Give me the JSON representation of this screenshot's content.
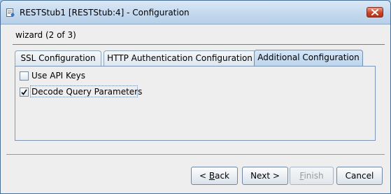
{
  "window": {
    "title": "RESTStub1 [RESTStub:4] - Configuration",
    "icon": "app-stub-icon",
    "close_icon": "close-icon"
  },
  "wizard": {
    "step_label": "wizard (2 of 3)"
  },
  "tabs": [
    {
      "label": "SSL Configuration",
      "active": false
    },
    {
      "label": "HTTP Authentication Configuration",
      "active": false
    },
    {
      "label": "Additional Configuration",
      "active": true
    }
  ],
  "options": [
    {
      "label": "Use API Keys",
      "checked": false
    },
    {
      "label": "Decode Query Parameters",
      "checked": true
    }
  ],
  "buttons": {
    "back": {
      "prefix": "< ",
      "mnemonic": "B",
      "rest": "ack"
    },
    "next": {
      "label": "Next >"
    },
    "finish": {
      "mnemonic": "F",
      "rest": "inish",
      "enabled": false
    },
    "cancel": {
      "label": "Cancel"
    }
  }
}
